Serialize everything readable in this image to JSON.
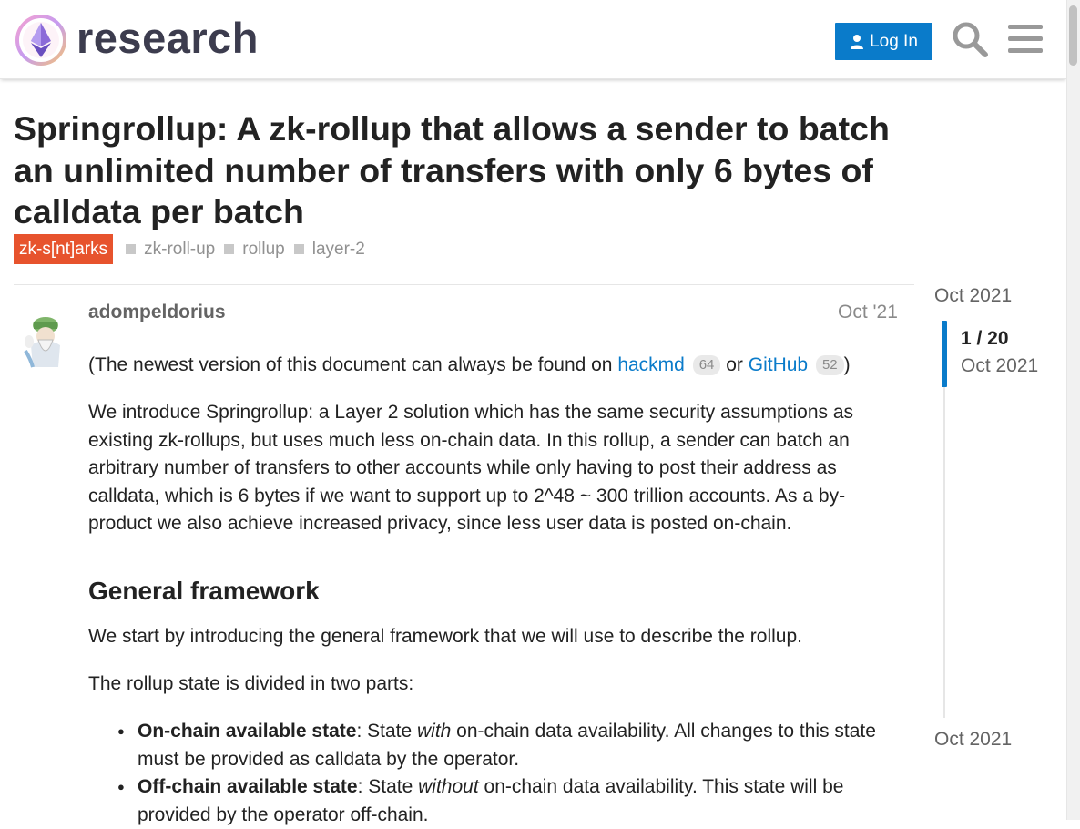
{
  "header": {
    "site_name": "research",
    "login_label": "Log In",
    "brand_color": "#0a7bca"
  },
  "topic": {
    "title": "Springrollup: A zk-rollup that allows a sender to batch an unlimited number of transfers with only 6 bytes of calldata per batch",
    "category": {
      "label": "zk-s[nt]arks",
      "color": "#e7532d"
    },
    "tags": [
      "zk-roll-up",
      "rollup",
      "layer-2"
    ]
  },
  "post": {
    "username": "adompeldorius",
    "date": "Oct '21",
    "intro": {
      "before": "(The newest version of this document can always be found on ",
      "link1": "hackmd",
      "count1": "64",
      "middle": " or ",
      "link2": "GitHub",
      "count2": "52",
      "after": ")"
    },
    "para2": "We introduce Springrollup: a Layer 2 solution which has the same security assumptions as existing zk-rollups, but uses much less on-chain data. In this rollup, a sender can batch an arbitrary number of transfers to other accounts while only having to post their address as calldata, which is 6 bytes if we want to support up to 2^48 ~ 300 trillion accounts. As a by-product we also achieve increased privacy, since less user data is posted on-chain.",
    "heading": "General framework",
    "para3": "We start by introducing the general framework that we will use to describe the rollup.",
    "para4": "The rollup state is divided in two parts:",
    "list": [
      {
        "bold": "On-chain available state",
        "pre": ": State ",
        "em": "with",
        "post": " on-chain data availability. All changes to this state must be provided as calldata by the operator."
      },
      {
        "bold": "Off-chain available state",
        "pre": ": State ",
        "em": "without",
        "post": " on-chain data availability. This state will be provided by the operator off-chain."
      }
    ]
  },
  "timeline": {
    "start": "Oct 2021",
    "position": "1 / 20",
    "current": "Oct 2021",
    "end": "Oct 2021"
  }
}
